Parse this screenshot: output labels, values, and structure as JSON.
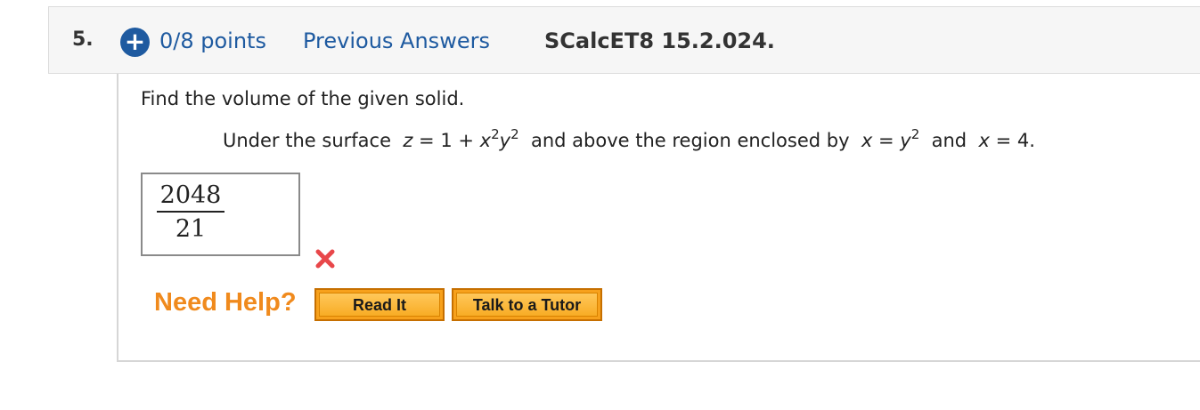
{
  "header": {
    "question_number": "5.",
    "plus_icon": "+",
    "points": "0/8 points",
    "previous_answers": "Previous Answers",
    "source": "SCalcET8 15.2.024."
  },
  "question": {
    "prompt": "Find the volume of the given solid.",
    "problem": {
      "t1": "Under the surface  ",
      "v_z": "z",
      "t2": " = 1 + ",
      "v_x": "x",
      "sup1": "2",
      "v_y": "y",
      "sup2": "2",
      "t3": "  and above the region enclosed by  ",
      "v_x2": "x",
      "t4": " = ",
      "v_y2": "y",
      "sup3": "2",
      "t5": "  and  ",
      "v_x3": "x",
      "t6": " = 4."
    }
  },
  "answer": {
    "numerator": "2048",
    "denominator": "21",
    "status_icon": "incorrect-x-icon",
    "status_color": "#e8474a"
  },
  "help": {
    "label": "Need Help?",
    "read_it": "Read It",
    "talk_to_tutor": "Talk to a Tutor",
    "accent": "#f08a1d"
  }
}
